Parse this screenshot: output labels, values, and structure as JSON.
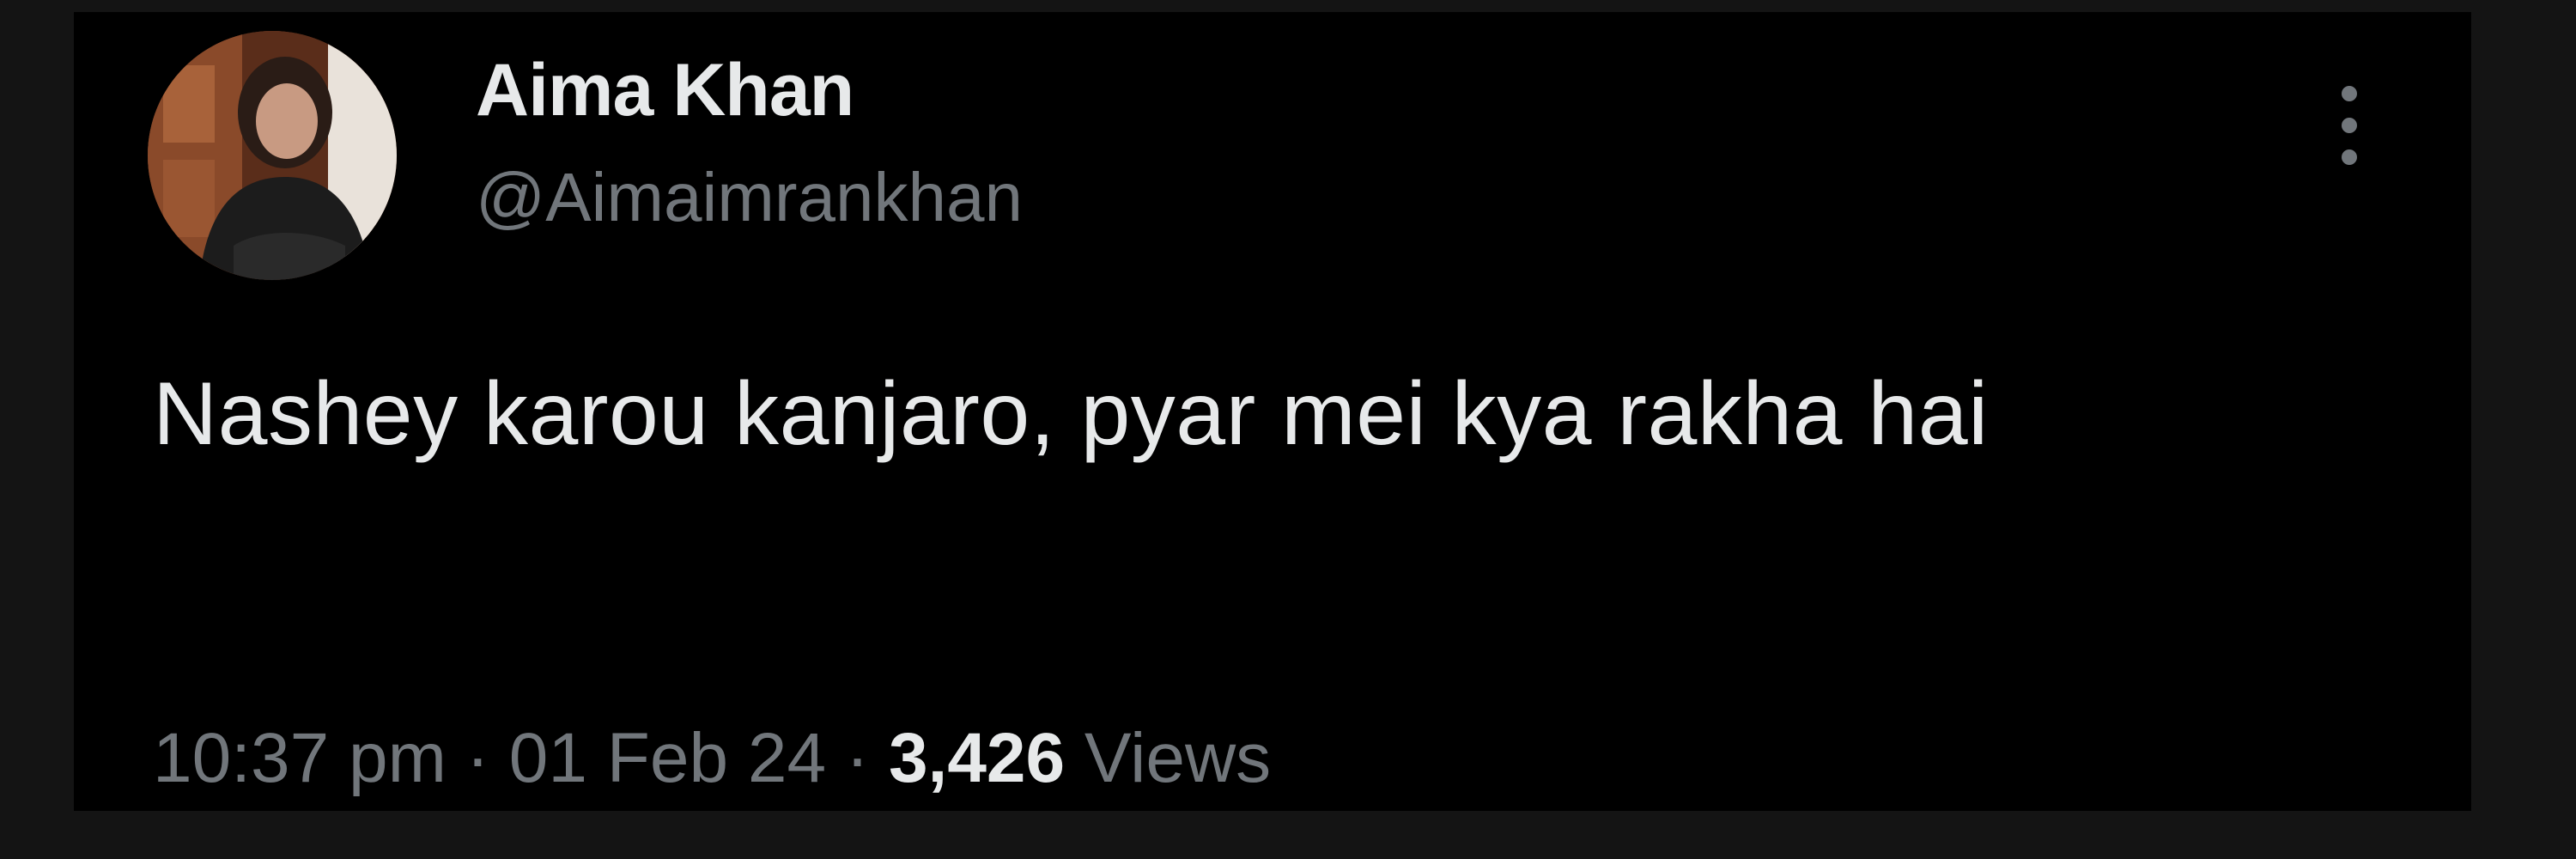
{
  "tweet": {
    "author": {
      "display_name": "Aima Khan",
      "handle": "@Aimaimrankhan",
      "avatar_icon": "profile-photo"
    },
    "text": "Nashey karou kanjaro, pyar mei kya rakha hai",
    "meta": {
      "time": "10:37 pm",
      "separator": " · ",
      "date": "01 Feb 24",
      "views_count": "3,426",
      "views_label": " Views"
    },
    "more_icon": "more-vertical-icon"
  },
  "colors": {
    "background": "#000000",
    "outer": "#141414",
    "primary_text": "#e7e9ea",
    "secondary_text": "#71767b"
  }
}
